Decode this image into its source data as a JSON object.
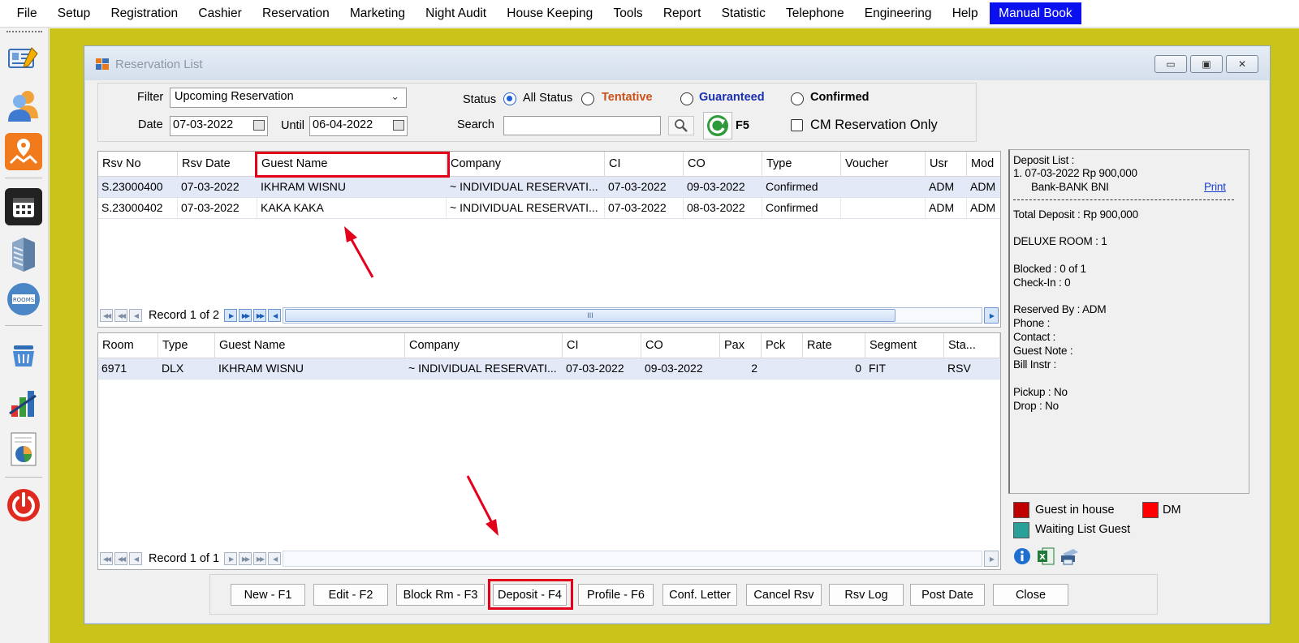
{
  "menu": {
    "items": [
      "File",
      "Setup",
      "Registration",
      "Cashier",
      "Reservation",
      "Marketing",
      "Night Audit",
      "House Keeping",
      "Tools",
      "Report",
      "Statistic",
      "Telephone",
      "Engineering",
      "Help"
    ],
    "highlight": "Manual Book"
  },
  "window": {
    "title": "Reservation List",
    "buttons": [
      "▭",
      "▣",
      "✕"
    ]
  },
  "filter": {
    "filter_label": "Filter",
    "filter_value": "Upcoming Reservation",
    "date_label": "Date",
    "date_value": "07-03-2022",
    "until_label": "Until",
    "until_value": "06-04-2022",
    "status_label": "Status",
    "status_options": [
      "All Status",
      "Tentative",
      "Guaranteed",
      "Confirmed"
    ],
    "status_selected": "All Status",
    "search_label": "Search",
    "search_value": "",
    "refresh_label": "F5",
    "cm_only_label": "CM Reservation Only"
  },
  "reservations": {
    "columns": [
      "Rsv No",
      "Rsv Date",
      "Guest Name",
      "Company",
      "CI",
      "CO",
      "Type",
      "Voucher",
      "Usr",
      "Mod"
    ],
    "rows": [
      [
        "S.23000400",
        "07-03-2022",
        "IKHRAM WISNU",
        "~ INDIVIDUAL RESERVATI...",
        "07-03-2022",
        "09-03-2022",
        "Confirmed",
        "",
        "ADM",
        "ADM"
      ],
      [
        "S.23000402",
        "07-03-2022",
        "KAKA KAKA",
        "~ INDIVIDUAL RESERVATI...",
        "07-03-2022",
        "08-03-2022",
        "Confirmed",
        "",
        "ADM",
        "ADM"
      ]
    ],
    "record_text": "Record 1 of 2",
    "scroll_thumb": "III"
  },
  "rooms": {
    "columns": [
      "Room",
      "Type",
      "Guest Name",
      "Company",
      "CI",
      "CO",
      "Pax",
      "Pck",
      "Rate",
      "Segment",
      "Sta..."
    ],
    "rows": [
      [
        "6971",
        "DLX",
        "IKHRAM WISNU",
        "~ INDIVIDUAL RESERVATI...",
        "07-03-2022",
        "09-03-2022",
        "2",
        "",
        "0",
        "FIT",
        "RSV"
      ]
    ],
    "record_text": "Record 1 of 1"
  },
  "info": {
    "deposit_list": "Deposit List :",
    "deposit_line": "1. 07-03-2022  Rp 900,000",
    "deposit_bank": "Bank-BANK BNI",
    "print_link": "Print",
    "total_deposit": "Total Deposit : Rp 900,000",
    "room_type": "DELUXE ROOM : 1",
    "blocked": "Blocked : 0 of 1",
    "checkin": "Check-In : 0",
    "reserved_by": "Reserved By : ADM",
    "phone": "Phone :",
    "contact": "Contact :",
    "guest_note": "Guest Note :",
    "bill_instr": "Bill Instr :",
    "pickup": "Pickup : No",
    "drop": "Drop : No"
  },
  "legend": {
    "guest_in_house": "Guest in house",
    "dm": "DM",
    "waiting_list": "Waiting List Guest",
    "colors": {
      "guest_in_house": "#c00000",
      "dm": "#ff0000",
      "waiting_list": "#2aa198"
    }
  },
  "buttons": [
    "New - F1",
    "Edit - F2",
    "Block Rm - F3",
    "Deposit - F4",
    "Profile  - F6",
    "Conf. Letter",
    "Cancel Rsv",
    "Rsv Log",
    "Post Date",
    "Close"
  ],
  "colors": {
    "mdi_background": "#c9c31a",
    "highlight": "#0a10ee",
    "annotation": "#e3001b",
    "tentative": "#c9511a",
    "guaranteed": "#1a2fb0"
  }
}
